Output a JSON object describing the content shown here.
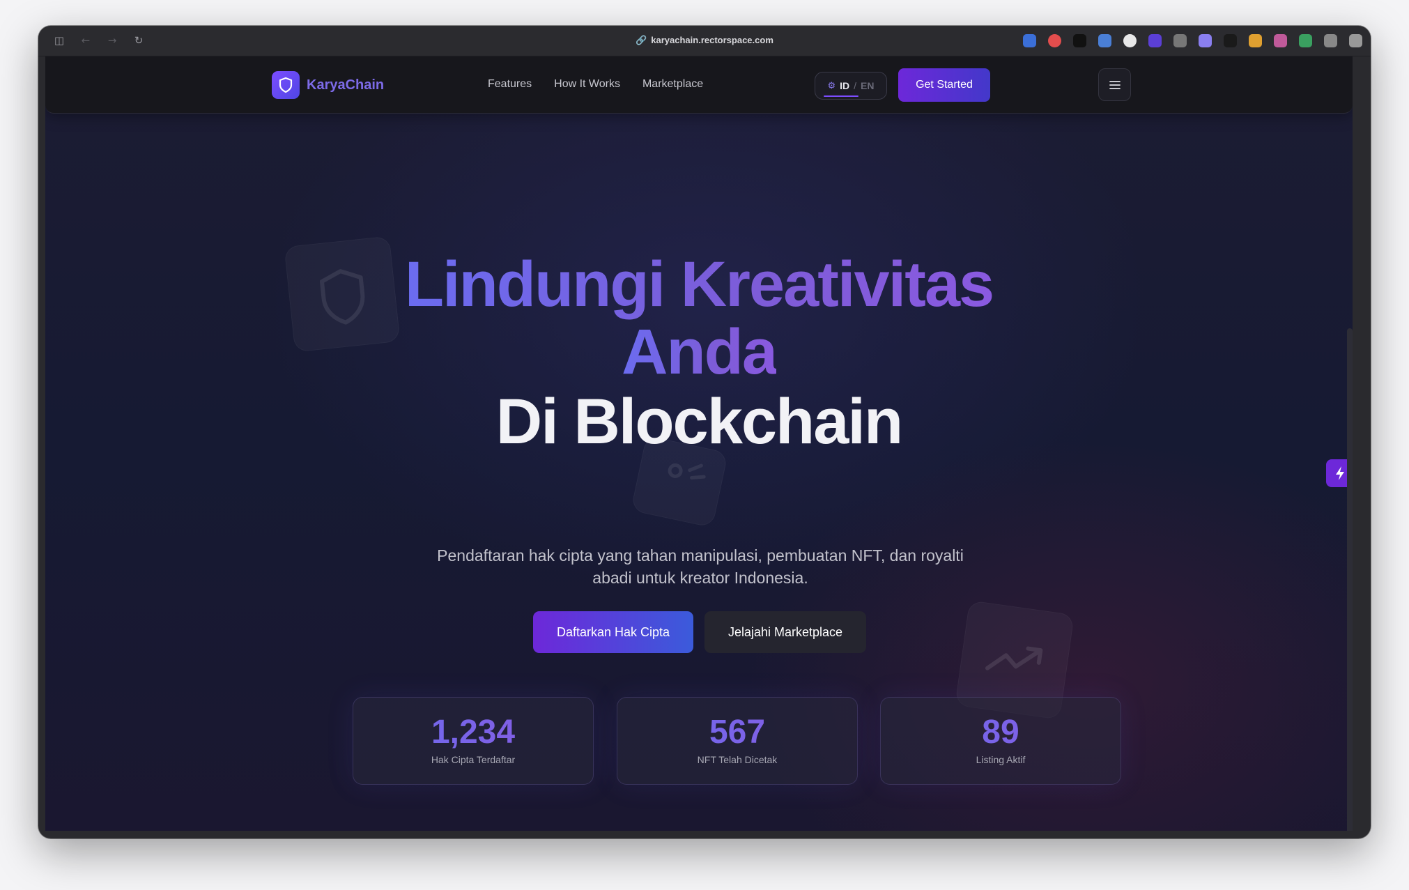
{
  "browser": {
    "url": "karyachain.rectorspace.com",
    "extension_colors": [
      "#3b6fd8",
      "#e34d4d",
      "#111111",
      "#4a7fd6",
      "#e8e8e8",
      "#5b3fd6",
      "#777777",
      "#8a7ff0",
      "#1a1a1a",
      "#e0a030",
      "#c05a9a",
      "#3aa060",
      "#888888",
      "#999999"
    ]
  },
  "nav": {
    "brand": "KaryaChain",
    "links": [
      "Features",
      "How It Works",
      "Marketplace"
    ],
    "lang_active": "ID",
    "lang_sep": "/",
    "lang_other": "EN",
    "cta": "Get Started"
  },
  "hero": {
    "line1": "Lindungi Kreativitas",
    "line2": "Anda",
    "line3": "Di Blockchain",
    "subtitle": "Pendaftaran hak cipta yang tahan manipulasi, pembuatan NFT, dan royalti abadi untuk kreator Indonesia.",
    "primary_button": "Daftarkan Hak Cipta",
    "secondary_button": "Jelajahi Marketplace"
  },
  "stats": [
    {
      "value": "1,234",
      "label": "Hak Cipta Terdaftar"
    },
    {
      "value": "567",
      "label": "NFT Telah Dicetak"
    },
    {
      "value": "89",
      "label": "Listing Aktif"
    }
  ],
  "colors": {
    "accent": "#6d28d9",
    "brand": "#7d6be8",
    "background": "#161a33"
  }
}
